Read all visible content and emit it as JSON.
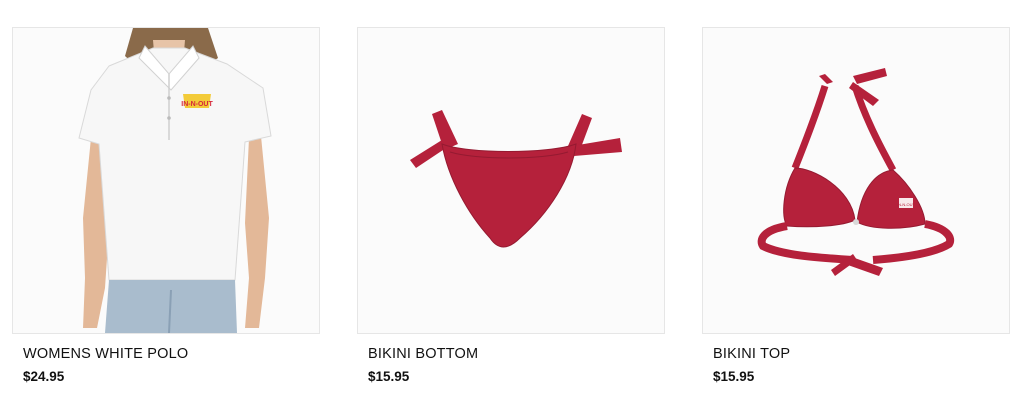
{
  "products": [
    {
      "name": "WOMENS WHITE POLO",
      "price": "$24.95",
      "image": "womens-white-polo",
      "logo_text": "IN-N-OUT"
    },
    {
      "name": "BIKINI BOTTOM",
      "price": "$15.95",
      "image": "bikini-bottom"
    },
    {
      "name": "BIKINI TOP",
      "price": "$15.95",
      "image": "bikini-top",
      "logo_text": "IN-N-OUT"
    }
  ],
  "colors": {
    "swimsuit_red": "#b5213b",
    "polo_white": "#f7f7f7",
    "logo_red": "#d6283a",
    "logo_yellow": "#f2c318"
  }
}
